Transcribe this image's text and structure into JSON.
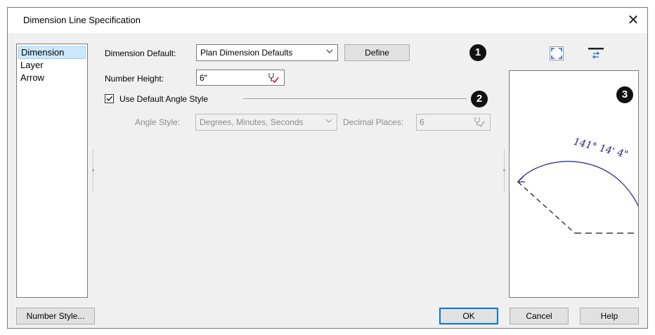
{
  "window": {
    "title": "Dimension Line Specification",
    "close_glyph": "✕"
  },
  "nav": {
    "items": [
      {
        "label": "Dimension",
        "selected": true
      },
      {
        "label": "Layer",
        "selected": false
      },
      {
        "label": "Arrow",
        "selected": false
      }
    ]
  },
  "dimension_default": {
    "label": "Dimension Default:",
    "value": "Plan Dimension Defaults",
    "define_label": "Define"
  },
  "number_height": {
    "label": "Number Height:",
    "value": "6\""
  },
  "angle": {
    "use_default_label": "Use Default Angle Style",
    "use_default_checked": true,
    "style_label": "Angle Style:",
    "style_value": "Degrees, Minutes, Seconds",
    "decimal_label": "Decimal Places:",
    "decimal_value": "6"
  },
  "callouts": {
    "one": "1",
    "two": "2",
    "three": "3"
  },
  "preview": {
    "angle_text": "141° 14' 4\""
  },
  "buttons": {
    "number_style": "Number Style...",
    "ok": "OK",
    "cancel": "Cancel",
    "help": "Help"
  },
  "icons": {
    "fit": "fill-window-icon",
    "swap": "swap-view-icon",
    "wrench_active": "wrench-check-icon",
    "wrench_disabled": "wrench-check-icon-disabled",
    "chevron": "chevron-down-icon",
    "close": "close-icon"
  },
  "colors": {
    "accent": "#0078d7",
    "selection": "#cce8ff",
    "arc": "#1f1f8f",
    "check_red": "#d03030"
  }
}
